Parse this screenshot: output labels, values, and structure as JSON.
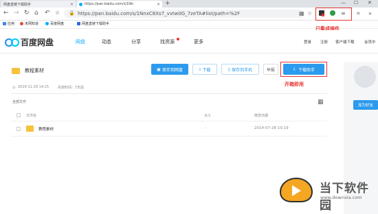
{
  "tabs": [
    {
      "title": "网盘直链下载助手",
      "close": "×"
    },
    {
      "title": "https://pan.baidu.com/s/1Nn",
      "close": "×"
    }
  ],
  "new_tab": "+",
  "window_controls": {
    "minimize": "—",
    "maximize": "☐",
    "close": "✕"
  },
  "address": {
    "url": "https://pan.baidu.com/s/1NnxC8Xs7_vvtw0G_7zeTA#list/path=%2F"
  },
  "bookmarks": [
    {
      "label": "应用",
      "color": "#4285f4"
    },
    {
      "label": "未网知道",
      "color": "#e8453c"
    },
    {
      "label": "百度网盘",
      "color": "#09aaff"
    },
    {
      "label": "网盘直链下载助手",
      "color": "#2c6bd6"
    }
  ],
  "annotations": {
    "extensions": "已集成插件",
    "helper": "开箱即用"
  },
  "header": {
    "brand": "百度网盘",
    "nav": [
      "网盘",
      "动态",
      "分享",
      "找资源",
      "更多"
    ],
    "right": [
      "登录",
      "注册",
      "客户端下载",
      "会员中"
    ]
  },
  "folder": {
    "name": "教程素材",
    "date": "2019-11-29 14:15",
    "expiry": "失效时间：7天后"
  },
  "toolbar": {
    "save": "保存到网盘",
    "download": "下载",
    "save_phone": "保存到手机",
    "report": "举报",
    "helper": "下载助手"
  },
  "list": {
    "all_files": "全部文件",
    "col_name": "文件名",
    "col_size": "大小",
    "col_date": "修改日期",
    "rows": [
      {
        "name": "教程素材",
        "size": "-",
        "date": "2014-07-28 10:19"
      }
    ]
  },
  "sidebar": {
    "add_friend": "加为好友"
  },
  "watermark": {
    "text": "当下软件园",
    "url": "www.downxia.com"
  },
  "colors": {
    "accent": "#09aaff",
    "button": "#2c9aed",
    "annotation": "#e5322d"
  }
}
